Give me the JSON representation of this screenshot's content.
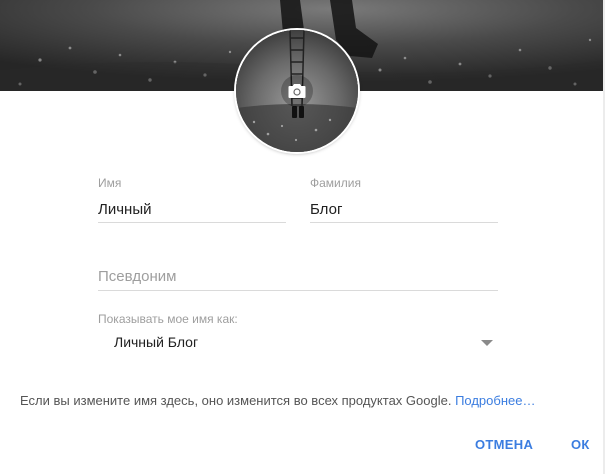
{
  "profile": {
    "cover_icon": "cover-photo",
    "avatar_icon": "camera-icon"
  },
  "form": {
    "first_name": {
      "label": "Имя",
      "value": "Личный"
    },
    "last_name": {
      "label": "Фамилия",
      "value": "Блог"
    },
    "nickname": {
      "placeholder": "Псевдоним",
      "value": ""
    },
    "display_as": {
      "label": "Показывать мое имя как:",
      "selected": "Личный Блог",
      "icon": "dropdown-arrow-icon"
    }
  },
  "info": {
    "text": "Если вы измените имя здесь, оно изменится во всех продуктах Google. ",
    "link": "Подробнее…"
  },
  "actions": {
    "cancel_label": "ОТМЕНА",
    "ok_label": "ОК"
  },
  "colors": {
    "accent": "#3b7de0",
    "label": "#9e9e9e",
    "text": "#212121",
    "divider": "#dadada"
  }
}
